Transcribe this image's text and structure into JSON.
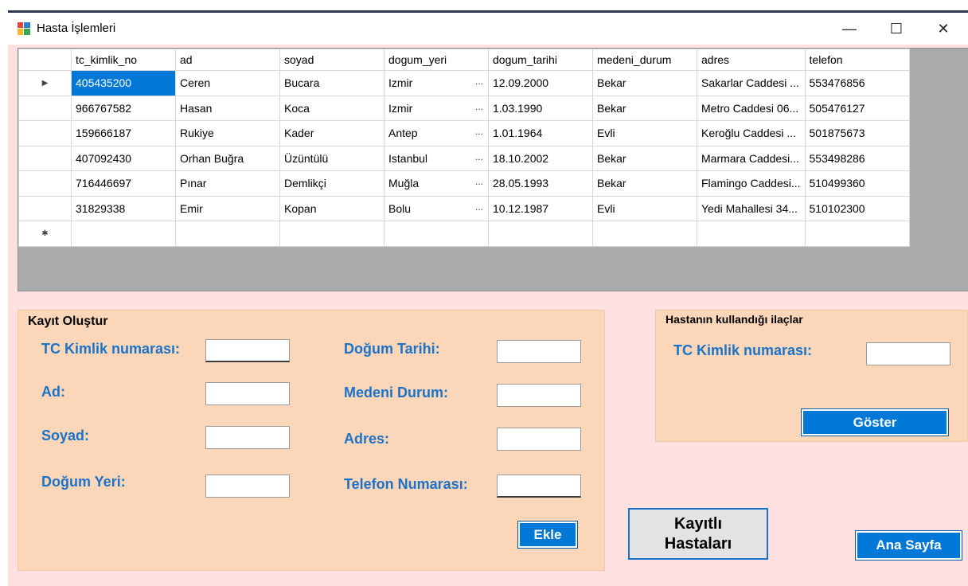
{
  "window": {
    "title": "Hasta İşlemleri",
    "controls": {
      "minimize": "—",
      "maximize": "☐",
      "close": "✕"
    }
  },
  "grid": {
    "columns": [
      "tc_kimlik_no",
      "ad",
      "soyad",
      "dogum_yeri",
      "dogum_tarihi",
      "medeni_durum",
      "adres",
      "telefon"
    ],
    "current_row_marker": "▶",
    "new_row_marker": "✱",
    "rows": [
      [
        "405435200",
        "Ceren",
        "Bucara",
        "Izmir",
        "12.09.2000",
        "Bekar",
        "Sakarlar Caddesi ...",
        "553476856"
      ],
      [
        "966767582",
        "Hasan",
        "Koca",
        "Izmir",
        "1.03.1990",
        "Bekar",
        "Metro Caddesi 06...",
        "505476127"
      ],
      [
        "159666187",
        "Rukiye",
        "Kader",
        "Antep",
        "1.01.1964",
        "Evli",
        "Keroğlu Caddesi ...",
        "501875673"
      ],
      [
        "407092430",
        "Orhan Buğra",
        "Üzüntülü",
        "Istanbul",
        "18.10.2002",
        "Bekar",
        "Marmara Caddesi...",
        "553498286"
      ],
      [
        "716446697",
        "Pınar",
        "Demlikçi",
        "Muğla",
        "28.05.1993",
        "Bekar",
        "Flamingo Caddesi...",
        "510499360"
      ],
      [
        "31829338",
        "Emir",
        "Kopan",
        "Bolu",
        "10.12.1987",
        "Evli",
        "Yedi Mahallesi 34...",
        "510102300"
      ]
    ],
    "ellipsis": "..."
  },
  "kayit": {
    "title": "Kayıt Oluştur",
    "tc_label": "TC Kimlik numarası:",
    "ad_label": "Ad:",
    "soyad_label": "Soyad:",
    "dogum_yeri_label": "Doğum Yeri:",
    "dogum_tarihi_label": "Doğum Tarihi:",
    "medeni_durum_label": "Medeni Durum:",
    "adres_label": "Adres:",
    "telefon_label": "Telefon Numarası:",
    "ekle_button": "Ekle"
  },
  "ilaclar": {
    "title": "Hastanın kullandığı ilaçlar",
    "tc_label": "TC Kimlik numarası:",
    "goster_button": "Göster"
  },
  "buttons": {
    "kayitli_line1": "Kayıtlı",
    "kayitli_line2": "Hastaları",
    "ana_sayfa": "Ana Sayfa"
  },
  "colors": {
    "form_background": "#ffe0e0",
    "panel_background": "#fcd6b8",
    "label_blue": "#1a73c8",
    "accent_blue": "#0078d7",
    "grid_background": "#ababab"
  }
}
